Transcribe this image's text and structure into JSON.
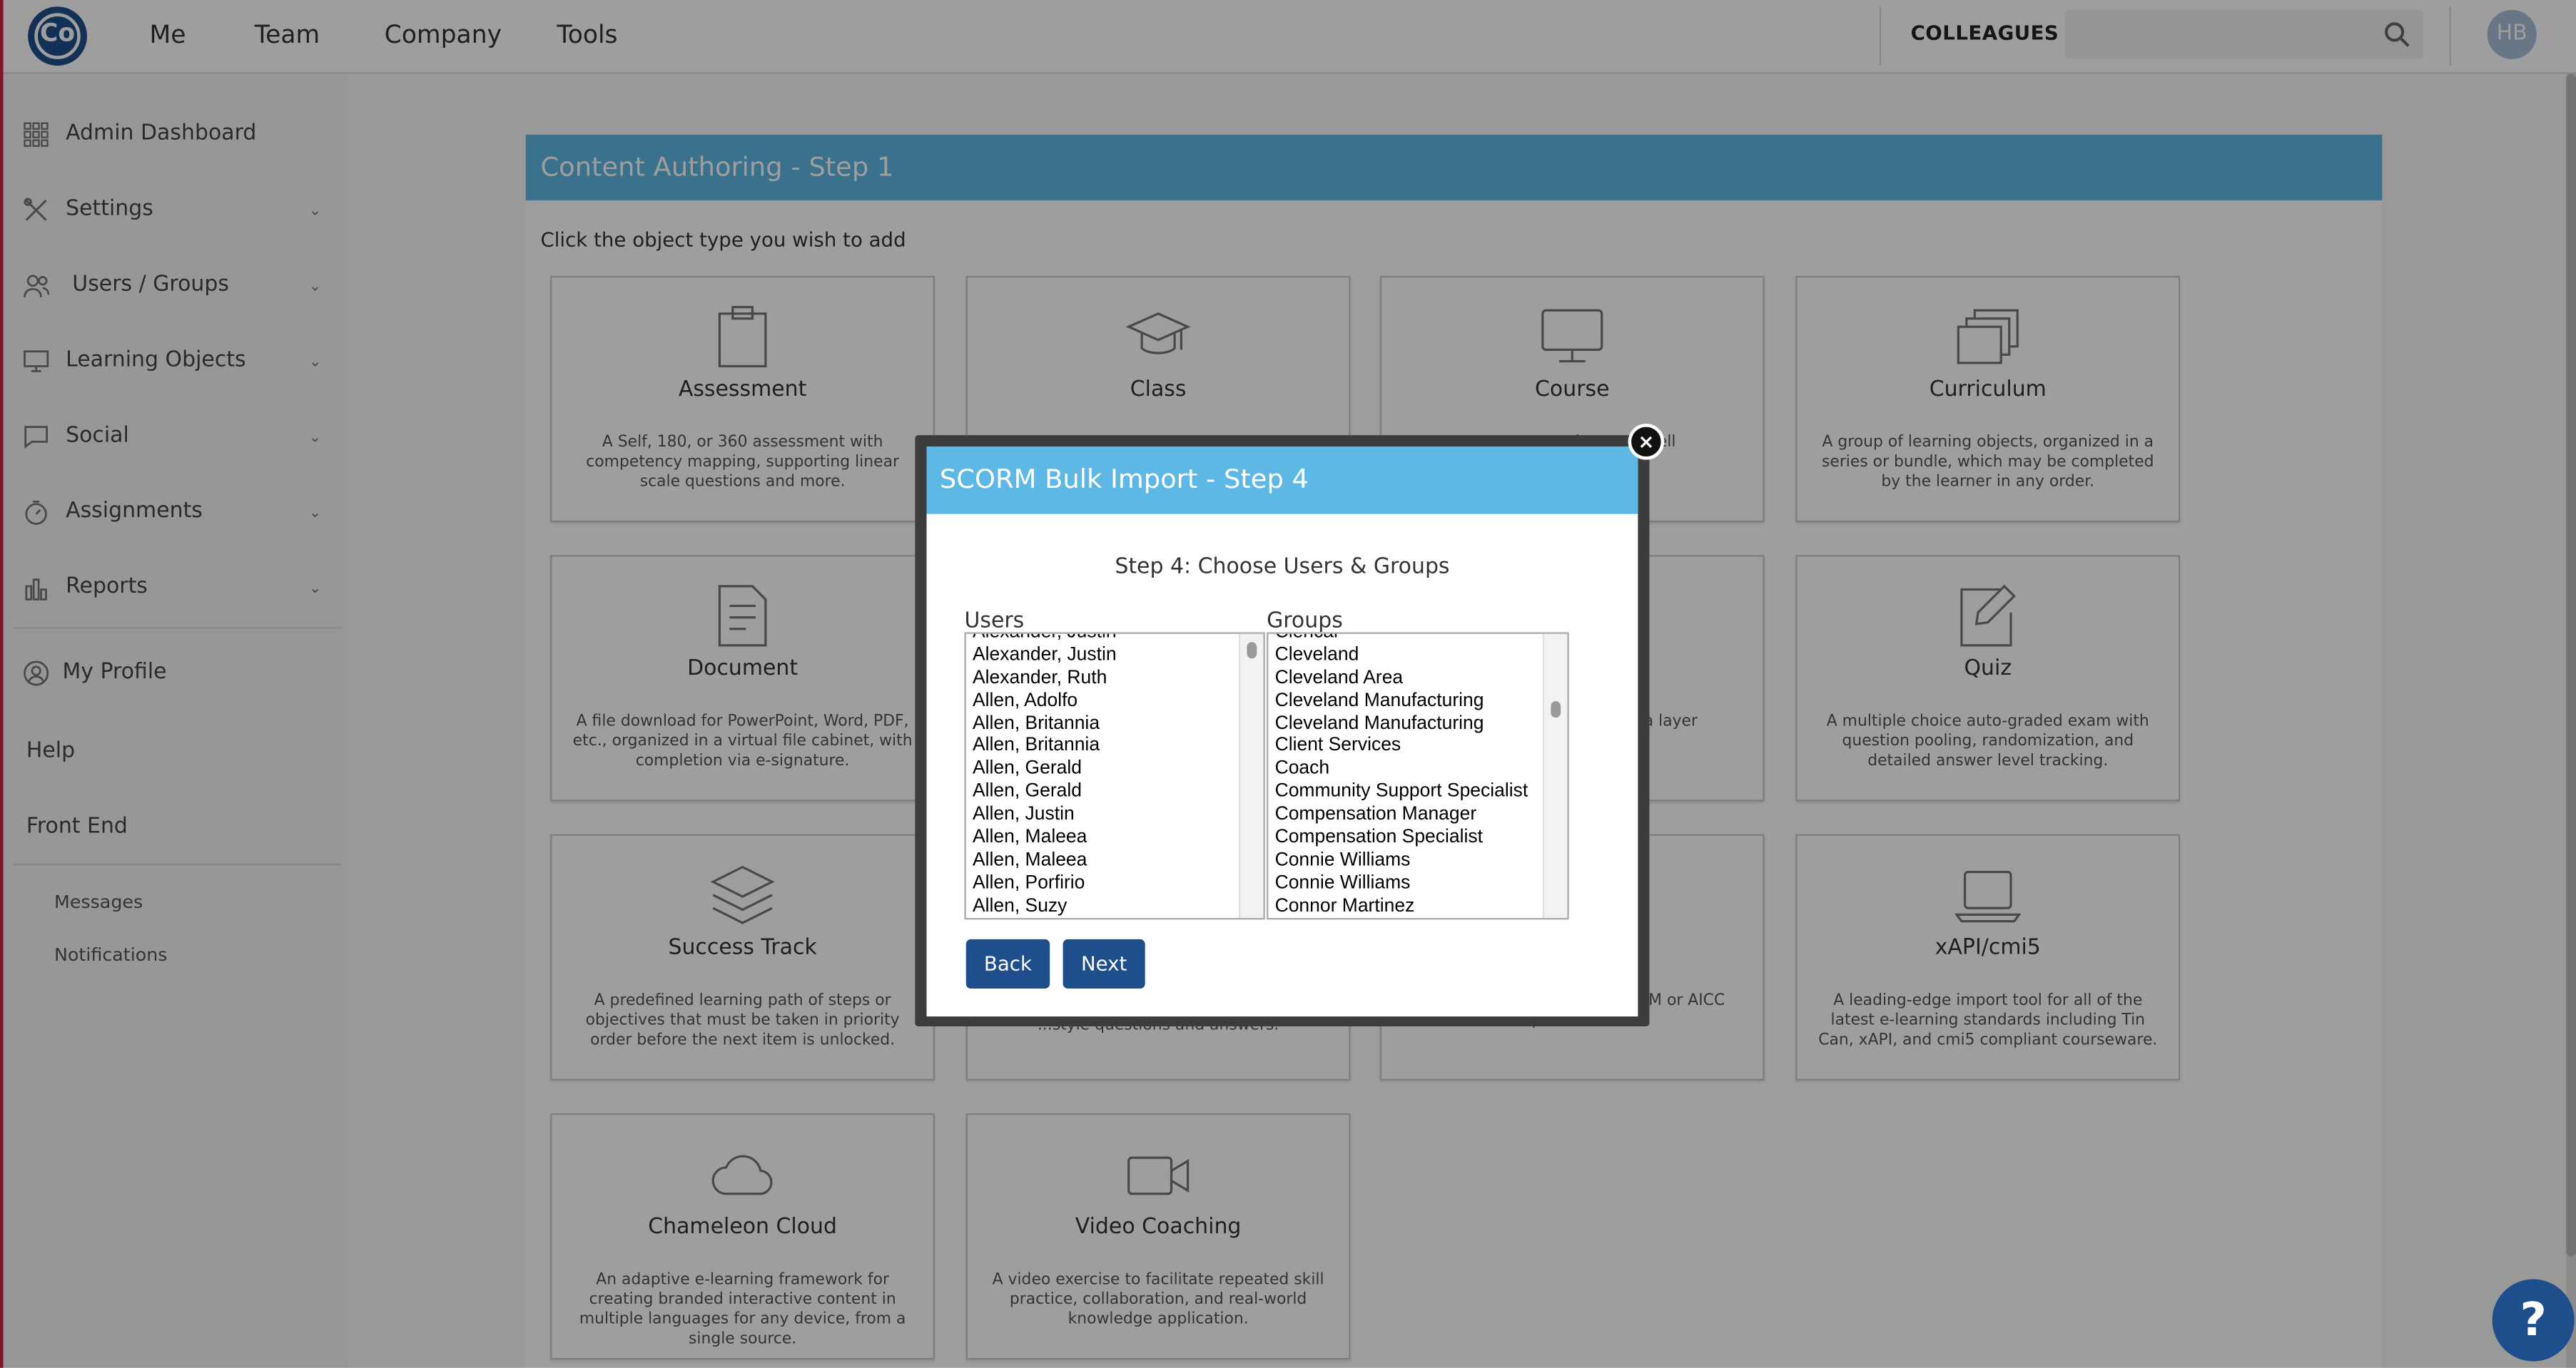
{
  "topnav": {
    "logo_text": "Co",
    "links": [
      "Me",
      "Team",
      "Company",
      "Tools"
    ],
    "colleagues_label": "COLLEAGUES",
    "search_placeholder": "",
    "avatar_initials": "HB"
  },
  "sidebar": {
    "items": [
      {
        "label": "Admin Dashboard",
        "icon": "grid-icon"
      },
      {
        "label": "Settings",
        "icon": "tools-icon"
      },
      {
        "label": "Users / Groups",
        "icon": "users-icon"
      },
      {
        "label": "Learning Objects",
        "icon": "monitor-icon"
      },
      {
        "label": "Social",
        "icon": "chat-icon"
      },
      {
        "label": "Assignments",
        "icon": "stopwatch-icon"
      },
      {
        "label": "Reports",
        "icon": "bar-chart-icon"
      },
      {
        "label": "My Profile",
        "icon": "user-circle-icon"
      },
      {
        "label": "Help"
      },
      {
        "label": "Front End"
      }
    ],
    "sub_items": [
      "Messages",
      "Notifications"
    ]
  },
  "main": {
    "panel_title": "Content Authoring - Step 1",
    "instruction": "Click the object type you wish to add",
    "cards": [
      {
        "title": "Assessment",
        "desc": "A Self, 180, or 360 assessment with competency mapping, supporting linear scale questions and more."
      },
      {
        "title": "Class",
        "desc": ""
      },
      {
        "title": "Course",
        "desc": "...ore steps ...jects, as well"
      },
      {
        "title": "Curriculum",
        "desc": "A group of learning objects, organized in a series or bundle, which may be completed by the learner in any order."
      },
      {
        "title": "Document",
        "desc": "A file download for PowerPoint, Word, PDF, etc., organized in a virtual file cabinet, with completion via e-signature."
      },
      {
        "title": "Quiz",
        "desc": "A multiple choice auto-graded exam with question pooling, randomization, and detailed answer level tracking."
      },
      {
        "title": "Success Track",
        "desc": "A predefined learning path of steps or objectives that must be taken in priority order before the next item is unlocked."
      },
      {
        "title": "",
        "desc": "...style questions and answers."
      },
      {
        "title": "",
        "desc": "...industry ...veloped in SCORM or AICC compliant formats."
      },
      {
        "title": "xAPI/cmi5",
        "desc": "A leading-edge import tool for all of the latest e-learning standards including Tin Can, xAPI, and cmi5 compliant courseware."
      },
      {
        "title": "Chameleon Cloud",
        "desc": "An adaptive e-learning framework for creating branded interactive content in multiple languages for any device, from a single source."
      },
      {
        "title": "Video Coaching",
        "desc": "A video exercise to facilitate repeated skill practice, collaboration, and real-world knowledge application."
      }
    ],
    "partial_desc_mid": "...anet URL's or ...S, with a layer"
  },
  "modal": {
    "title": "SCORM Bulk Import - Step 4",
    "step_title": "Step 4: Choose Users & Groups",
    "users_label": "Users",
    "groups_label": "Groups",
    "users": [
      "Alexander, Justin",
      "Alexander, Justin",
      "Alexander, Ruth",
      "Allen, Adolfo",
      "Allen, Britannia",
      "Allen, Britannia",
      "Allen, Gerald",
      "Allen, Gerald",
      "Allen, Justin",
      "Allen, Maleea",
      "Allen, Maleea",
      "Allen, Porfirio",
      "Allen, Suzy"
    ],
    "groups": [
      "Clerical",
      "Cleveland",
      "Cleveland Area",
      "Cleveland Manufacturing",
      "Cleveland Manufacturing",
      "Client Services",
      "Coach",
      "Community Support Specialist",
      "Compensation Manager",
      "Compensation Specialist",
      "Connie Williams",
      "Connie Williams",
      "Connor Martinez"
    ],
    "back_label": "Back",
    "next_label": "Next",
    "close_label": "×"
  },
  "help_label": "?",
  "colors": {
    "brand": "#1f4e8c",
    "header_blue": "#5eb8e6"
  }
}
